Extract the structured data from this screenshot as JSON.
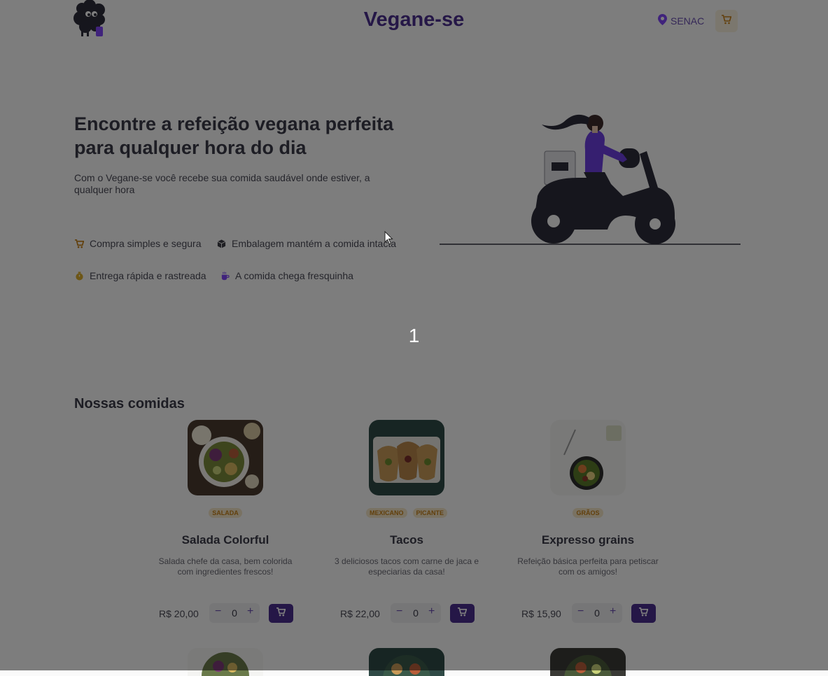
{
  "header": {
    "brand": "Vegane-se",
    "location": "SENAC",
    "logo_icon": "sheep-logo-icon",
    "location_icon": "map-pin-icon",
    "cart_icon": "cart-icon"
  },
  "hero": {
    "title": "Encontre a refeição vegana perfeita para qualquer hora do dia",
    "subtitle": "Com o Vegane-se você recebe sua comida saudável onde estiver, a qualquer hora",
    "features": [
      {
        "icon": "cart-icon",
        "label": "Compra simples e segura",
        "color": "#c47f17"
      },
      {
        "icon": "package-icon",
        "label": "Embalagem mantém a comida intacta",
        "color": "#3f3f46"
      },
      {
        "icon": "timer-icon",
        "label": "Entrega rápida e rastreada",
        "color": "#dbac2c"
      },
      {
        "icon": "coffee-icon",
        "label": "A comida chega fresquinha",
        "color": "#8047f8"
      }
    ]
  },
  "overlay": {
    "counter": "1"
  },
  "menu": {
    "title": "Nossas comidas",
    "items": [
      {
        "name": "Salada Colorful",
        "tags": [
          "SALADA"
        ],
        "description": "Salada chefe da casa, bem colorida com ingredientes frescos!",
        "price": "R$ 20,00",
        "quantity": "0"
      },
      {
        "name": "Tacos",
        "tags": [
          "MEXICANO",
          "PICANTE"
        ],
        "description": "3 deliciosos tacos com carne de jaca e especiarias da casa!",
        "price": "R$ 22,00",
        "quantity": "0"
      },
      {
        "name": "Expresso grains",
        "tags": [
          "GRÃOS"
        ],
        "description": "Refeição básica perfeita para petiscar com os amigos!",
        "price": "R$ 15,90",
        "quantity": "0"
      }
    ],
    "qty_minus": "−",
    "qty_plus": "+"
  },
  "colors": {
    "brand": "#4b2e8f",
    "accent": "#8047f8",
    "tag": "#c47f17",
    "overlay": "rgba(0,0,0,0.5)"
  }
}
